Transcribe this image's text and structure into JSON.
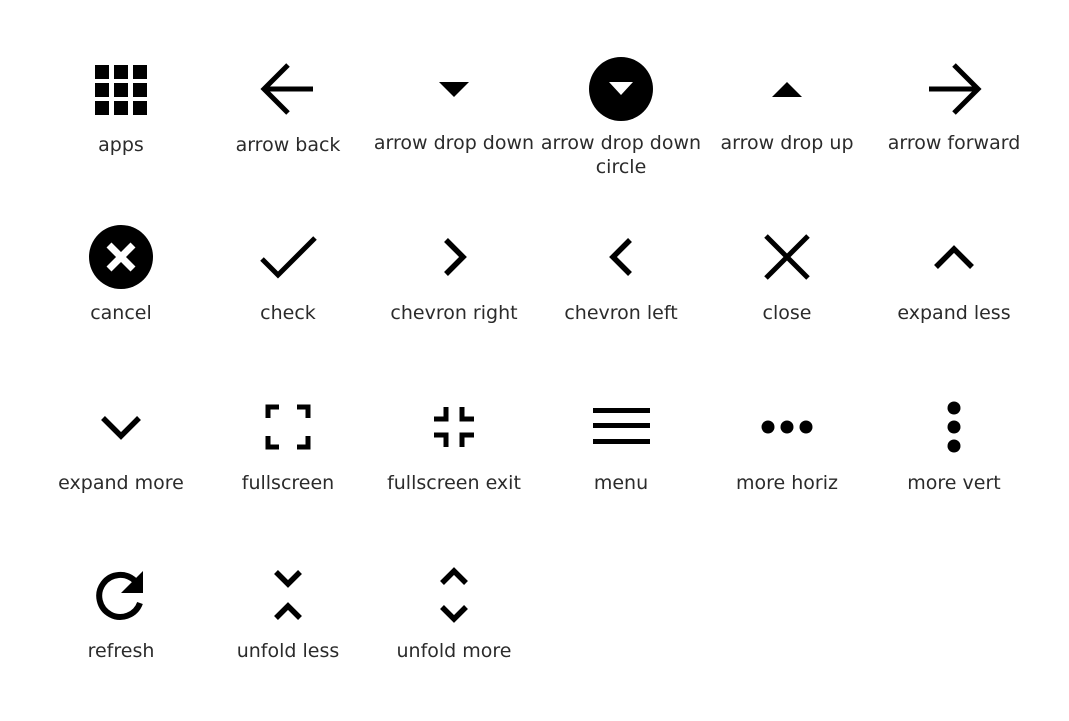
{
  "icon_color": "#000000",
  "label_color": "#2b2b2b",
  "icons": [
    {
      "name": "apps",
      "label": "apps"
    },
    {
      "name": "arrow-back",
      "label": "arrow back"
    },
    {
      "name": "arrow-drop-down",
      "label": "arrow drop down"
    },
    {
      "name": "arrow-drop-down-circle",
      "label": "arrow drop down circle"
    },
    {
      "name": "arrow-drop-up",
      "label": "arrow drop up"
    },
    {
      "name": "arrow-forward",
      "label": "arrow forward"
    },
    {
      "name": "cancel",
      "label": "cancel"
    },
    {
      "name": "check",
      "label": "check"
    },
    {
      "name": "chevron-right",
      "label": "chevron right"
    },
    {
      "name": "chevron-left",
      "label": "chevron left"
    },
    {
      "name": "close",
      "label": "close"
    },
    {
      "name": "expand-less",
      "label": "expand less"
    },
    {
      "name": "expand-more",
      "label": "expand more"
    },
    {
      "name": "fullscreen",
      "label": "fullscreen"
    },
    {
      "name": "fullscreen-exit",
      "label": "fullscreen exit"
    },
    {
      "name": "menu",
      "label": "menu"
    },
    {
      "name": "more-horiz",
      "label": "more horiz"
    },
    {
      "name": "more-vert",
      "label": "more vert"
    },
    {
      "name": "refresh",
      "label": "refresh"
    },
    {
      "name": "unfold-less",
      "label": "unfold less"
    },
    {
      "name": "unfold-more",
      "label": "unfold more"
    }
  ]
}
